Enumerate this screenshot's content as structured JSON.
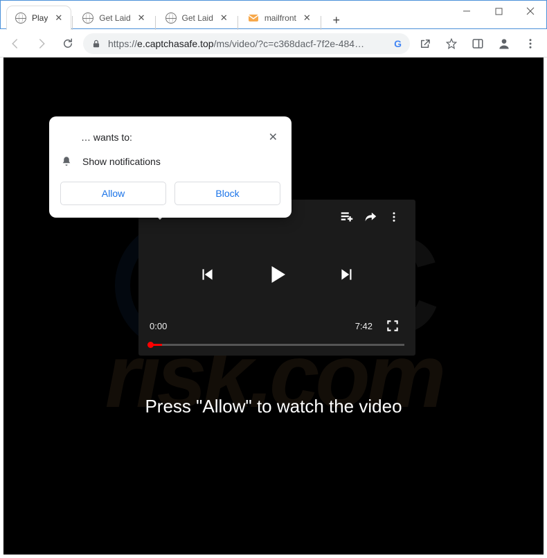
{
  "tabs": [
    {
      "title": "Play",
      "active": true,
      "favicon": "globe"
    },
    {
      "title": "Get Laid",
      "active": false,
      "favicon": "globe"
    },
    {
      "title": "Get Laid",
      "active": false,
      "favicon": "globe"
    },
    {
      "title": "mailfront",
      "active": false,
      "favicon": "mail"
    }
  ],
  "url": {
    "protocol": "https://",
    "host": "e.captchasafe.top",
    "path": "/ms/video/?c=c368dacf-7f2e-484…"
  },
  "notification": {
    "title": "… wants to:",
    "permission_text": "Show notifications",
    "allow_label": "Allow",
    "block_label": "Block"
  },
  "player": {
    "current_time": "0:00",
    "duration": "7:42"
  },
  "caption": "Press \"Allow\" to watch the video",
  "watermark": {
    "top": "PC",
    "bottom": "risk.com"
  }
}
